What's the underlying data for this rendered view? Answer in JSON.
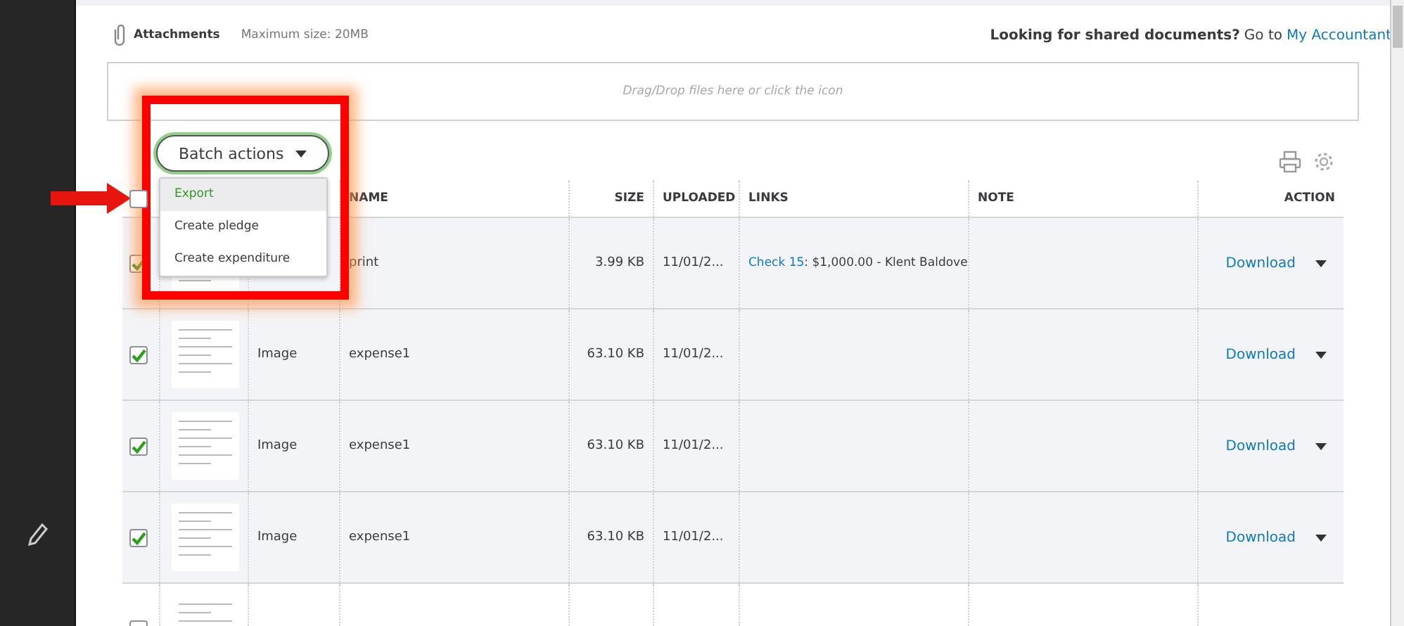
{
  "attachments": {
    "title": "Attachments",
    "max_size": "Maximum size: 20MB",
    "shared_prompt": "Looking for shared documents?",
    "go_to": "Go to",
    "link": "My Accountant"
  },
  "dropzone": {
    "hint": "Drag/Drop files here or click the icon"
  },
  "batch_actions": {
    "label": "Batch actions",
    "expanded": true,
    "menu": [
      {
        "label": "Export",
        "selected": true
      },
      {
        "label": "Create pledge",
        "selected": false
      },
      {
        "label": "Create expenditure",
        "selected": false
      }
    ]
  },
  "table": {
    "select_all_checked": false,
    "columns": [
      "NAME",
      "SIZE",
      "UPLOADED",
      "LINKS",
      "NOTE",
      "ACTION"
    ],
    "rows": [
      {
        "checked": true,
        "name": "print",
        "size": "3.99 KB",
        "uploaded": "11/01/2...",
        "link": "Check 15",
        "link_rest": ": $1,000.00 - Klent Baldove",
        "action": "Download"
      },
      {
        "checked": true,
        "type": "Image",
        "name": "expense1",
        "size": "63.10 KB",
        "uploaded": "11/01/2...",
        "action": "Download"
      },
      {
        "checked": true,
        "type": "Image",
        "name": "expense1",
        "size": "63.10 KB",
        "uploaded": "11/01/2...",
        "action": "Download"
      },
      {
        "checked": true,
        "type": "Image",
        "name": "expense1",
        "size": "63.10 KB",
        "uploaded": "11/01/2...",
        "action": "Download"
      },
      {
        "checked": false
      }
    ]
  },
  "annotations": {
    "highlight_frame": true,
    "arrow": true
  }
}
